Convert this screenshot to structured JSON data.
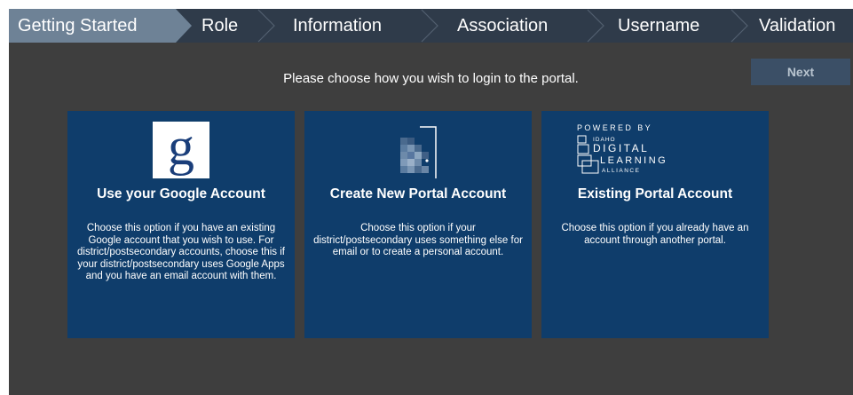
{
  "steps": [
    "Getting Started",
    "Role",
    "Information",
    "Association",
    "Username",
    "Validation"
  ],
  "instruction": "Please choose how you wish to login to the portal.",
  "next_label": "Next",
  "cards": [
    {
      "icon": "google-g-icon",
      "icon_glyph": "g",
      "title": "Use your Google Account",
      "description": "Choose this option if you have an existing Google account that you wish to use. For district/postsecondary accounts, choose this if your district/postsecondary uses Google Apps and you have an email account with them."
    },
    {
      "icon": "portal-account-icon",
      "title": "Create New Portal Account",
      "description": "Choose this option if your district/postsecondary uses something else for email or to create a personal account."
    },
    {
      "icon": "idla-logo",
      "logo_text": [
        "POWERED BY",
        "IDAHO",
        "DIGITAL",
        "LEARNING",
        "ALLIANCE"
      ],
      "title": "Existing Portal Account",
      "description": "Choose this option if you already have an account through another portal."
    }
  ],
  "colors": {
    "background": "#3e3e3e",
    "steps_bar": "#2f3b4a",
    "active_step": "#6e8296",
    "card": "#0f3d6b",
    "next_button": "#3b4f66"
  }
}
